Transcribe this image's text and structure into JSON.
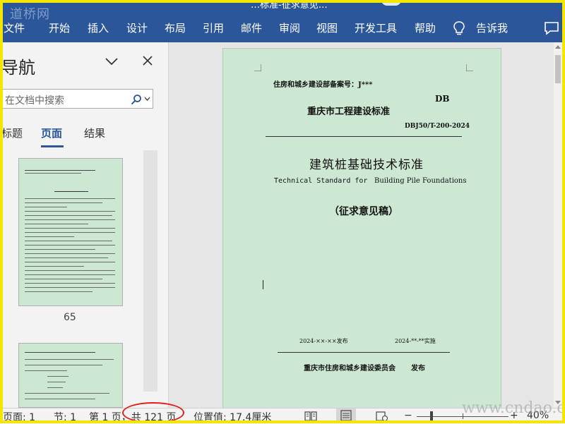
{
  "window": {
    "title_fragment": "…标准-征求意见…",
    "watermark_logo": "道桥网",
    "watermark_url": "www.cndao.com"
  },
  "ribbon": {
    "tabs": [
      "文件",
      "开始",
      "插入",
      "设计",
      "布局",
      "引用",
      "邮件",
      "审阅",
      "视图",
      "开发工具",
      "帮助"
    ],
    "tell_me": "告诉我",
    "icons": [
      "lightbulb-icon",
      "comment-icon"
    ]
  },
  "nav": {
    "title": "导航",
    "search_placeholder": "在文档中搜索",
    "tabs": [
      "标题",
      "页面",
      "结果"
    ],
    "active_tab": "页面",
    "thumb1_page": "65"
  },
  "doc": {
    "record_no": "住房和城乡建设部备案号：J***",
    "db": "DB",
    "series": "重庆市工程建设标准",
    "code": "DBJ50/T-200-2024",
    "title_cn": "建筑桩基础技术标准",
    "title_en_a": "Technical Standard for",
    "title_en_b": "Building Pile Foundations",
    "draft": "（征求意见稿）",
    "publish_date": "2024-××-××发布",
    "impl_date": "2024-**-**实施",
    "publisher": "重庆市住房和城乡建设委员会",
    "publish_word": "发布"
  },
  "status": {
    "page": "页面: 1",
    "section": "节: 1",
    "page_of": "第 1 页，共 121 页",
    "position": "位置值: 17.4厘米",
    "zoom": "40%",
    "minus": "−",
    "plus": "+"
  },
  "colors": {
    "ribbon": "#2b579a",
    "page_bg": "#cde8d2",
    "annotation": "#e0201c",
    "frame": "#f5e600"
  }
}
